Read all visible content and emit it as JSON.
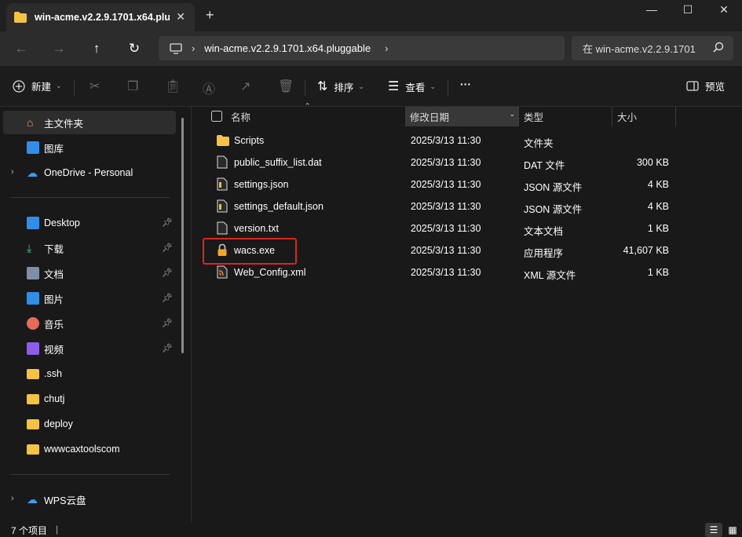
{
  "tab": {
    "title": "win-acme.v2.2.9.1701.x64.plug",
    "close": "✕",
    "new": "+"
  },
  "window": {
    "minimize": "—",
    "maximize": "☐",
    "close": "✕"
  },
  "nav": {
    "back": "←",
    "forward": "→",
    "up": "↑",
    "refresh": "↻",
    "path": "win-acme.v2.2.9.1701.x64.pluggable",
    "search_placeholder": "在 win-acme.v2.2.9.1701"
  },
  "toolbar": {
    "new_label": "新建",
    "sort_label": "排序",
    "view_label": "查看",
    "more": "···",
    "preview_label": "预览"
  },
  "sidebar": {
    "home": "主文件夹",
    "gallery": "图库",
    "onedrive": "OneDrive - Personal",
    "quick": [
      {
        "label": "Desktop"
      },
      {
        "label": "下载"
      },
      {
        "label": "文档"
      },
      {
        "label": "图片"
      },
      {
        "label": "音乐"
      },
      {
        "label": "视频"
      },
      {
        "label": ".ssh"
      },
      {
        "label": "chutj"
      },
      {
        "label": "deploy"
      },
      {
        "label": "wwwcaxtoolscom"
      }
    ],
    "wps": "WPS云盘"
  },
  "columns": {
    "name": "名称",
    "date": "修改日期",
    "type": "类型",
    "size": "大小"
  },
  "files": [
    {
      "name": "Scripts",
      "date": "2025/3/13 11:30",
      "type": "文件夹",
      "size": "",
      "icon": "folder"
    },
    {
      "name": "public_suffix_list.dat",
      "date": "2025/3/13 11:30",
      "type": "DAT 文件",
      "size": "300 KB",
      "icon": "file"
    },
    {
      "name": "settings.json",
      "date": "2025/3/13 11:30",
      "type": "JSON 源文件",
      "size": "4 KB",
      "icon": "json"
    },
    {
      "name": "settings_default.json",
      "date": "2025/3/13 11:30",
      "type": "JSON 源文件",
      "size": "4 KB",
      "icon": "json"
    },
    {
      "name": "version.txt",
      "date": "2025/3/13 11:30",
      "type": "文本文档",
      "size": "1 KB",
      "icon": "file"
    },
    {
      "name": "wacs.exe",
      "date": "2025/3/13 11:30",
      "type": "应用程序",
      "size": "41,607 KB",
      "icon": "lock"
    },
    {
      "name": "Web_Config.xml",
      "date": "2025/3/13 11:30",
      "type": "XML 源文件",
      "size": "1 KB",
      "icon": "xml"
    }
  ],
  "status": {
    "count": "7 个项目",
    "separator": "|"
  },
  "colors": {
    "highlight": "#e0241b",
    "folder": "#f5c242",
    "accent": "#4da3ff"
  }
}
